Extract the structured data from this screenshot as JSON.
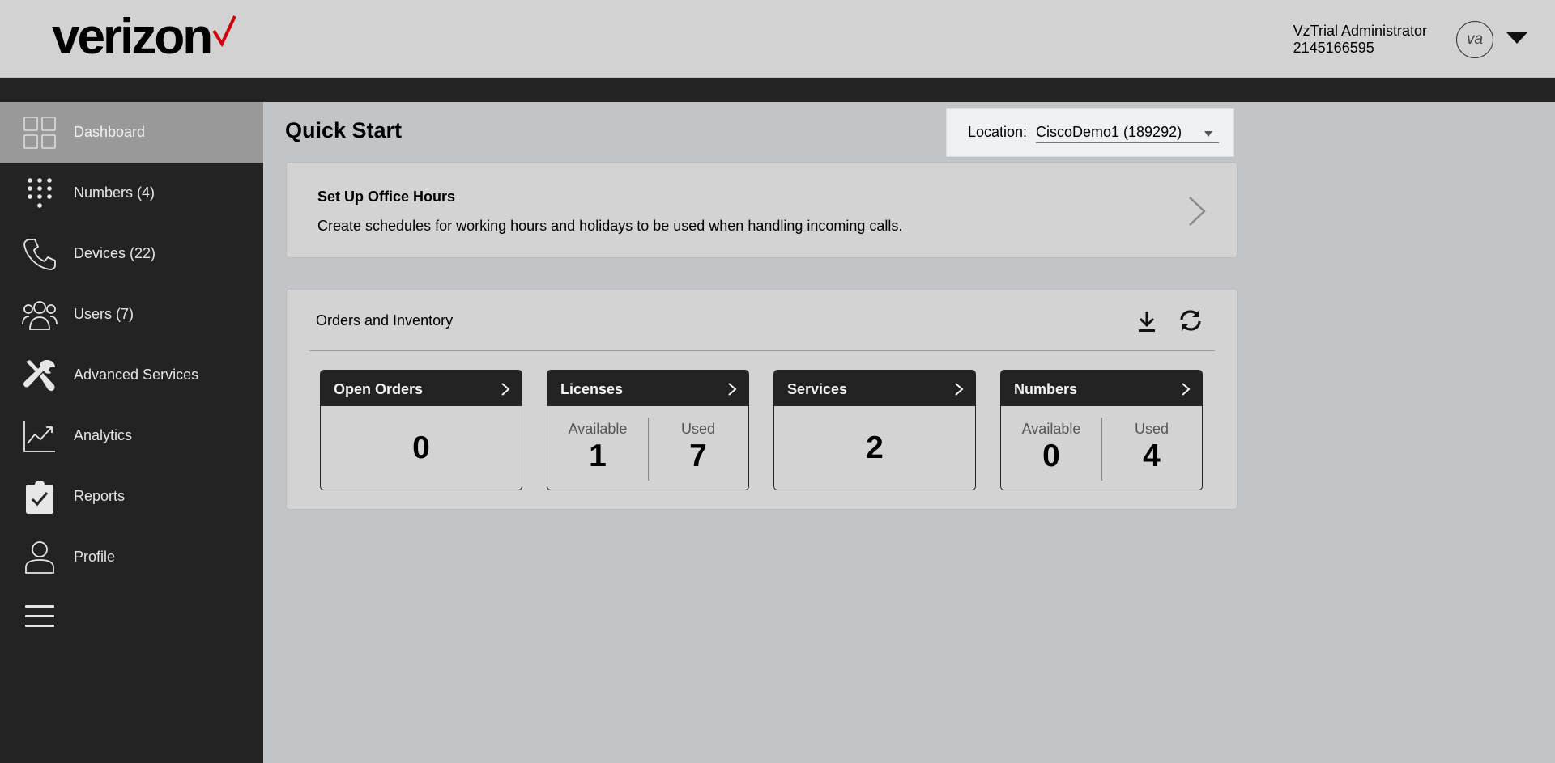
{
  "header": {
    "logo_text": "verizon",
    "user_name": "VzTrial Administrator",
    "user_phone": "2145166595",
    "avatar_initials": "va"
  },
  "sidebar": {
    "items": [
      {
        "label": "Dashboard",
        "icon": "dashboard-grid-icon",
        "active": true
      },
      {
        "label": "Numbers (4)",
        "icon": "dialpad-icon"
      },
      {
        "label": "Devices (22)",
        "icon": "phone-icon"
      },
      {
        "label": "Users (7)",
        "icon": "users-icon"
      },
      {
        "label": "Advanced Services",
        "icon": "tools-icon"
      },
      {
        "label": "Analytics",
        "icon": "line-chart-icon"
      },
      {
        "label": "Reports",
        "icon": "clipboard-check-icon"
      },
      {
        "label": "Profile",
        "icon": "profile-icon"
      }
    ],
    "menu_icon": "hamburger-menu-icon"
  },
  "main": {
    "title": "Quick Start",
    "location": {
      "label": "Location:",
      "value": "CiscoDemo1 (189292)"
    },
    "office_hours": {
      "title": "Set Up Office Hours",
      "description": "Create schedules for working hours and holidays to be used when handling incoming calls."
    },
    "orders": {
      "title": "Orders and Inventory",
      "tiles": [
        {
          "label": "Open Orders",
          "value": "0"
        },
        {
          "label": "Licenses",
          "available_label": "Available",
          "available": "1",
          "used_label": "Used",
          "used": "7"
        },
        {
          "label": "Services",
          "value": "2"
        },
        {
          "label": "Numbers",
          "available_label": "Available",
          "available": "0",
          "used_label": "Used",
          "used": "4"
        }
      ]
    }
  },
  "colors": {
    "brand_red": "#cd040b",
    "sidebar_bg": "#232323",
    "active_bg": "#999999",
    "page_bg": "#c2c5c8"
  }
}
